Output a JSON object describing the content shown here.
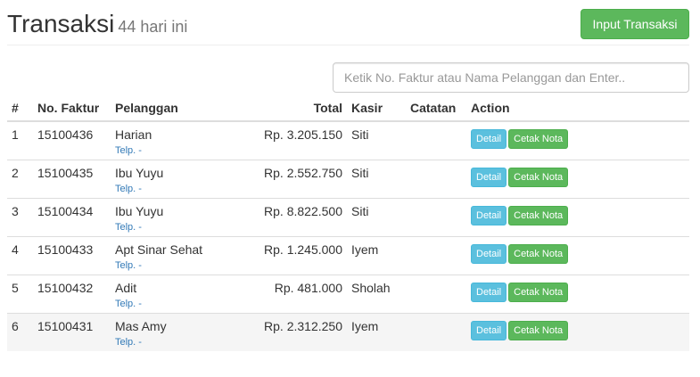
{
  "header": {
    "title": "Transaksi",
    "subtitle": "44 hari ini",
    "input_button": "Input Transaksi"
  },
  "search": {
    "placeholder": "Ketik No. Faktur atau Nama Pelanggan dan Enter.."
  },
  "table": {
    "columns": [
      "#",
      "No. Faktur",
      "Pelanggan",
      "Total",
      "Kasir",
      "Catatan",
      "Action"
    ],
    "rows": [
      {
        "num": "1",
        "faktur": "15100436",
        "pelanggan": "Harian",
        "telp": "Telp. -",
        "total": "Rp. 3.205.150",
        "kasir": "Siti",
        "catatan": "",
        "detail": "Detail",
        "cetak": "Cetak Nota"
      },
      {
        "num": "2",
        "faktur": "15100435",
        "pelanggan": "Ibu Yuyu",
        "telp": "Telp. -",
        "total": "Rp. 2.552.750",
        "kasir": "Siti",
        "catatan": "",
        "detail": "Detail",
        "cetak": "Cetak Nota"
      },
      {
        "num": "3",
        "faktur": "15100434",
        "pelanggan": "Ibu Yuyu",
        "telp": "Telp. -",
        "total": "Rp. 8.822.500",
        "kasir": "Siti",
        "catatan": "",
        "detail": "Detail",
        "cetak": "Cetak Nota"
      },
      {
        "num": "4",
        "faktur": "15100433",
        "pelanggan": "Apt Sinar Sehat",
        "telp": "Telp. -",
        "total": "Rp. 1.245.000",
        "kasir": "Iyem",
        "catatan": "",
        "detail": "Detail",
        "cetak": "Cetak Nota"
      },
      {
        "num": "5",
        "faktur": "15100432",
        "pelanggan": "Adit",
        "telp": "Telp. -",
        "total": "Rp. 481.000",
        "kasir": "Sholah",
        "catatan": "",
        "detail": "Detail",
        "cetak": "Cetak Nota"
      },
      {
        "num": "6",
        "faktur": "15100431",
        "pelanggan": "Mas Amy",
        "telp": "Telp. -",
        "total": "Rp. 2.312.250",
        "kasir": "Iyem",
        "catatan": "",
        "detail": "Detail",
        "cetak": "Cetak Nota"
      }
    ]
  }
}
